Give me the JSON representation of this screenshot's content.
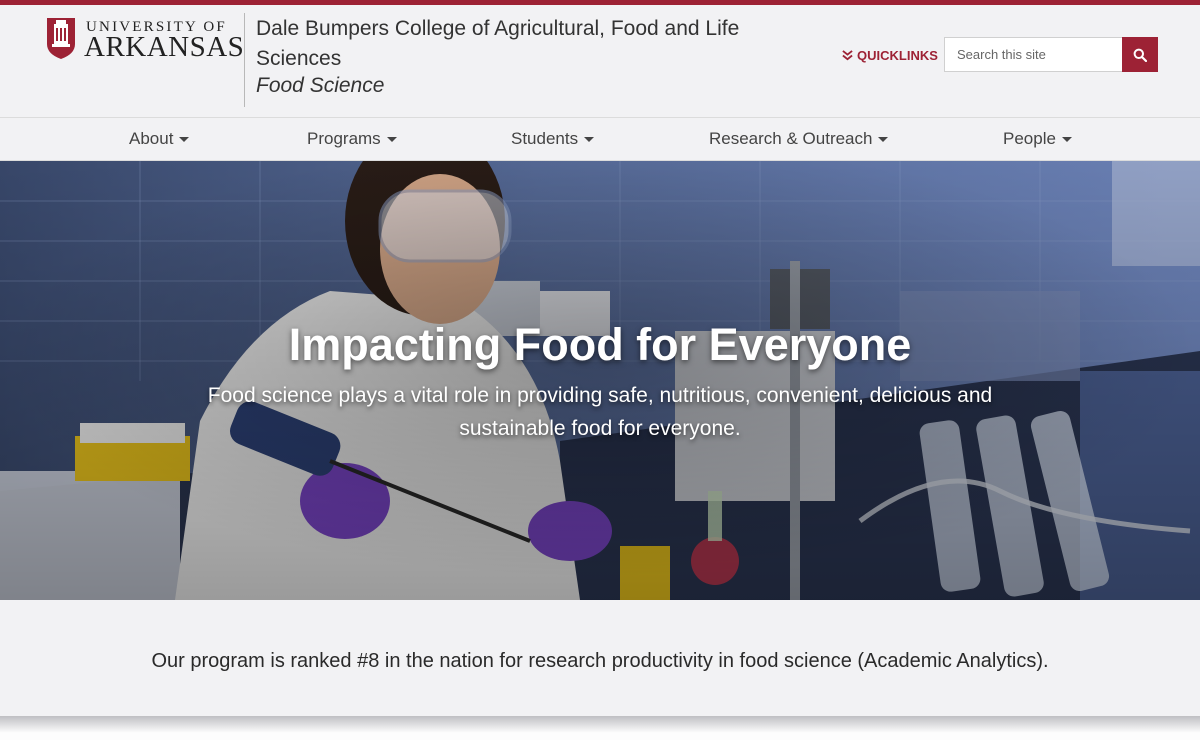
{
  "brand": {
    "university_top": "UNIVERSITY OF",
    "university_bottom": "ARKANSAS",
    "college": "Dale Bumpers College of Agricultural, Food and Life Sciences",
    "department": "Food Science",
    "accent_color": "#9d2235"
  },
  "header": {
    "quicklinks_label": "QUICKLINKS",
    "search_placeholder": "Search this site"
  },
  "nav": {
    "items": [
      {
        "label": "About"
      },
      {
        "label": "Programs"
      },
      {
        "label": "Students"
      },
      {
        "label": "Research & Outreach"
      },
      {
        "label": "People"
      }
    ]
  },
  "hero": {
    "title": "Impacting Food for Everyone",
    "subtitle": "Food science plays a vital role in providing safe, nutritious, convenient, delicious and sustainable food for everyone."
  },
  "ranking": {
    "text": "Our program is ranked #8 in the nation for research productivity in food science (Academic Analytics)."
  },
  "icons": {
    "quicklinks": "double-chevron-down-icon",
    "search": "search-icon"
  }
}
